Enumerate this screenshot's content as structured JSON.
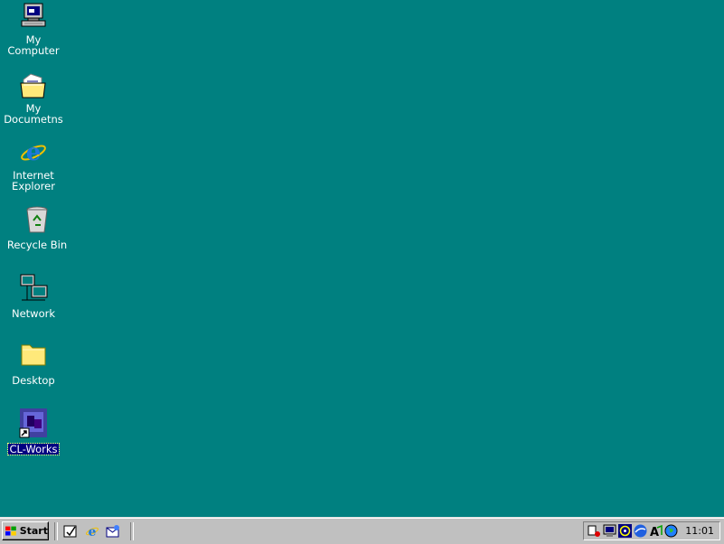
{
  "desktop": {
    "icons": [
      {
        "label1": "My",
        "label2": "Computer"
      },
      {
        "label1": "My",
        "label2": "Documetns"
      },
      {
        "label1": "Internet",
        "label2": "Explorer"
      },
      {
        "label1": "Recycle Bin"
      },
      {
        "label1": "Network"
      },
      {
        "label1": "Desktop"
      },
      {
        "label1": "CL-Works"
      }
    ],
    "background_color": "#008080"
  },
  "taskbar": {
    "start_label": "Start",
    "quick_launch": [
      "show-desktop-icon",
      "internet-explorer-icon",
      "outlook-express-icon"
    ],
    "tray_icons": [
      "volume-icon",
      "display-icon",
      "media-icon",
      "network-icon",
      "font-icon",
      "globe-icon"
    ],
    "clock": "11:01"
  }
}
